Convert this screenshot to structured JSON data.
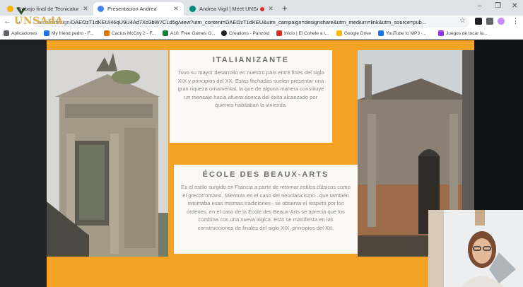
{
  "tabs": [
    {
      "label": "Trabajo final de Tecnicatura - Vig",
      "fav_color": "#f4b400",
      "active": false
    },
    {
      "label": "Presentacion Andrea",
      "fav_color": "#4285f4",
      "active": true
    },
    {
      "label": "Andrea Vigil | Meet UNSAdA",
      "fav_color": "#00897b",
      "active": false
    }
  ],
  "address": {
    "prefix": "a.com/design/",
    "url": "DAEOzT1dKEU/46qU9U4Ad7Xd3bW7CLd5g/view?utm_content=DAEOzT1dKEU&utm_campaign=designshare&utm_medium=link&utm_source=pub..."
  },
  "bookmarks": [
    {
      "label": "Aplicaciones",
      "color": "#5f6368"
    },
    {
      "label": "My friend pedro - F...",
      "color": "#1a73e8"
    },
    {
      "label": "Cactus McCoy 2 - F...",
      "color": "#e37400"
    },
    {
      "label": "A10: Free Games O...",
      "color": "#188038"
    },
    {
      "label": "Creations - Panzoid",
      "color": "#202124"
    },
    {
      "label": "Inicio | El Cohete a l...",
      "color": "#d93025"
    },
    {
      "label": "Google Drive",
      "color": "#fbbc04"
    },
    {
      "label": "YouTube to MP3 -...",
      "color": "#1a73e8"
    },
    {
      "label": "Juegos de tocar la...",
      "color": "#9334e6"
    }
  ],
  "logo": {
    "text": "UNSAdA"
  },
  "slide": {
    "section1": {
      "title": "ITALIANIZANTE",
      "body": "Tuvo su mayor desarrollo en nuestro país entre fines del siglo XIX y principios del XX. Estas fachadas suelen presentar una gran riqueza ornamental, la que de alguna manera constituye un mensaje hacia afuera acerca del éxito alcanzado por quienes habitaban la vivienda."
    },
    "section2": {
      "title": "ÉCOLE DES BEAUX-ARTS",
      "body": "Es el estilo surgido en Francia a partir de retomar estilos clásicos como el grecorromano. Mientras en el caso del neoclasicismo –que también retomaba esas mismas tradiciones– se observa el respeto por los órdenes, en el caso de la École des Beaux-Arts se aprecia que los combina con una nueva lógica. Esto se manifiesta en las construcciones de finales del siglo XIX, principios del XX."
    }
  },
  "colors": {
    "slide_bg": "#f4a324",
    "text_box": "#fbf9f5"
  }
}
